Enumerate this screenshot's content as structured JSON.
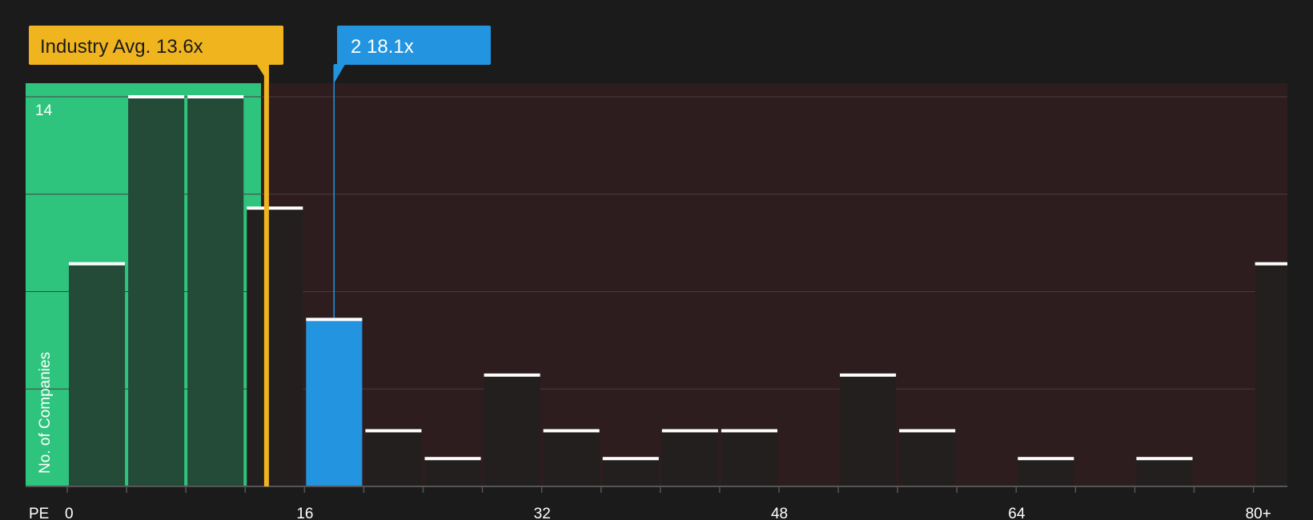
{
  "chart_data": {
    "type": "bar",
    "x_axis_label": "PE",
    "y_axis_label": "No. of Companies",
    "y_max_label": "14",
    "ylim": [
      0,
      14.5
    ],
    "x_ticks": [
      "0",
      "16",
      "32",
      "48",
      "64",
      "80+"
    ],
    "bin_width": 4,
    "bin_starts": [
      0,
      4,
      8,
      12,
      16,
      20,
      24,
      28,
      32,
      36,
      40,
      44,
      48,
      52,
      56,
      60,
      64,
      68,
      72,
      76,
      80
    ],
    "values": [
      8,
      14,
      14,
      10,
      6,
      2,
      1,
      4,
      2,
      1,
      2,
      2,
      0,
      4,
      2,
      0,
      1,
      0,
      1,
      0,
      8
    ],
    "industry_avg": {
      "label": "Industry Avg. 13.6x",
      "value": 13.6
    },
    "company": {
      "label": "2 18.1x",
      "value": 18.1,
      "bin_start": 16
    },
    "colors": {
      "background": "#1b1b1b",
      "undervalued_zone": "#2fc47d",
      "overvalued_zone": "#2e1d1f",
      "bar_default": "#231f1f",
      "bar_in_green": "#244b38",
      "bar_company": "#2394e0",
      "bar_cap": "#ffffff",
      "industry": "#f0b41e",
      "company": "#2394e0",
      "grid": "#4a3c3e",
      "axis": "#555555"
    }
  }
}
